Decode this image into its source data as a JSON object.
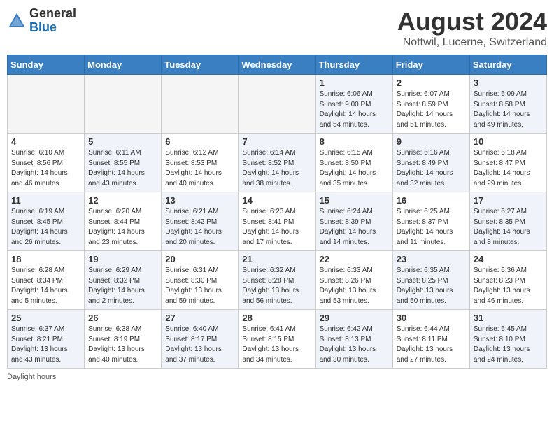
{
  "header": {
    "logo_line1": "General",
    "logo_line2": "Blue",
    "title": "August 2024",
    "subtitle": "Nottwil, Lucerne, Switzerland"
  },
  "days_of_week": [
    "Sunday",
    "Monday",
    "Tuesday",
    "Wednesday",
    "Thursday",
    "Friday",
    "Saturday"
  ],
  "weeks": [
    [
      {
        "day": "",
        "info": "",
        "empty": true
      },
      {
        "day": "",
        "info": "",
        "empty": true
      },
      {
        "day": "",
        "info": "",
        "empty": true
      },
      {
        "day": "",
        "info": "",
        "empty": true
      },
      {
        "day": "1",
        "info": "Sunrise: 6:06 AM\nSunset: 9:00 PM\nDaylight: 14 hours\nand 54 minutes.",
        "empty": false
      },
      {
        "day": "2",
        "info": "Sunrise: 6:07 AM\nSunset: 8:59 PM\nDaylight: 14 hours\nand 51 minutes.",
        "empty": false
      },
      {
        "day": "3",
        "info": "Sunrise: 6:09 AM\nSunset: 8:58 PM\nDaylight: 14 hours\nand 49 minutes.",
        "empty": false
      }
    ],
    [
      {
        "day": "4",
        "info": "Sunrise: 6:10 AM\nSunset: 8:56 PM\nDaylight: 14 hours\nand 46 minutes.",
        "empty": false
      },
      {
        "day": "5",
        "info": "Sunrise: 6:11 AM\nSunset: 8:55 PM\nDaylight: 14 hours\nand 43 minutes.",
        "empty": false
      },
      {
        "day": "6",
        "info": "Sunrise: 6:12 AM\nSunset: 8:53 PM\nDaylight: 14 hours\nand 40 minutes.",
        "empty": false
      },
      {
        "day": "7",
        "info": "Sunrise: 6:14 AM\nSunset: 8:52 PM\nDaylight: 14 hours\nand 38 minutes.",
        "empty": false
      },
      {
        "day": "8",
        "info": "Sunrise: 6:15 AM\nSunset: 8:50 PM\nDaylight: 14 hours\nand 35 minutes.",
        "empty": false
      },
      {
        "day": "9",
        "info": "Sunrise: 6:16 AM\nSunset: 8:49 PM\nDaylight: 14 hours\nand 32 minutes.",
        "empty": false
      },
      {
        "day": "10",
        "info": "Sunrise: 6:18 AM\nSunset: 8:47 PM\nDaylight: 14 hours\nand 29 minutes.",
        "empty": false
      }
    ],
    [
      {
        "day": "11",
        "info": "Sunrise: 6:19 AM\nSunset: 8:45 PM\nDaylight: 14 hours\nand 26 minutes.",
        "empty": false
      },
      {
        "day": "12",
        "info": "Sunrise: 6:20 AM\nSunset: 8:44 PM\nDaylight: 14 hours\nand 23 minutes.",
        "empty": false
      },
      {
        "day": "13",
        "info": "Sunrise: 6:21 AM\nSunset: 8:42 PM\nDaylight: 14 hours\nand 20 minutes.",
        "empty": false
      },
      {
        "day": "14",
        "info": "Sunrise: 6:23 AM\nSunset: 8:41 PM\nDaylight: 14 hours\nand 17 minutes.",
        "empty": false
      },
      {
        "day": "15",
        "info": "Sunrise: 6:24 AM\nSunset: 8:39 PM\nDaylight: 14 hours\nand 14 minutes.",
        "empty": false
      },
      {
        "day": "16",
        "info": "Sunrise: 6:25 AM\nSunset: 8:37 PM\nDaylight: 14 hours\nand 11 minutes.",
        "empty": false
      },
      {
        "day": "17",
        "info": "Sunrise: 6:27 AM\nSunset: 8:35 PM\nDaylight: 14 hours\nand 8 minutes.",
        "empty": false
      }
    ],
    [
      {
        "day": "18",
        "info": "Sunrise: 6:28 AM\nSunset: 8:34 PM\nDaylight: 14 hours\nand 5 minutes.",
        "empty": false
      },
      {
        "day": "19",
        "info": "Sunrise: 6:29 AM\nSunset: 8:32 PM\nDaylight: 14 hours\nand 2 minutes.",
        "empty": false
      },
      {
        "day": "20",
        "info": "Sunrise: 6:31 AM\nSunset: 8:30 PM\nDaylight: 13 hours\nand 59 minutes.",
        "empty": false
      },
      {
        "day": "21",
        "info": "Sunrise: 6:32 AM\nSunset: 8:28 PM\nDaylight: 13 hours\nand 56 minutes.",
        "empty": false
      },
      {
        "day": "22",
        "info": "Sunrise: 6:33 AM\nSunset: 8:26 PM\nDaylight: 13 hours\nand 53 minutes.",
        "empty": false
      },
      {
        "day": "23",
        "info": "Sunrise: 6:35 AM\nSunset: 8:25 PM\nDaylight: 13 hours\nand 50 minutes.",
        "empty": false
      },
      {
        "day": "24",
        "info": "Sunrise: 6:36 AM\nSunset: 8:23 PM\nDaylight: 13 hours\nand 46 minutes.",
        "empty": false
      }
    ],
    [
      {
        "day": "25",
        "info": "Sunrise: 6:37 AM\nSunset: 8:21 PM\nDaylight: 13 hours\nand 43 minutes.",
        "empty": false
      },
      {
        "day": "26",
        "info": "Sunrise: 6:38 AM\nSunset: 8:19 PM\nDaylight: 13 hours\nand 40 minutes.",
        "empty": false
      },
      {
        "day": "27",
        "info": "Sunrise: 6:40 AM\nSunset: 8:17 PM\nDaylight: 13 hours\nand 37 minutes.",
        "empty": false
      },
      {
        "day": "28",
        "info": "Sunrise: 6:41 AM\nSunset: 8:15 PM\nDaylight: 13 hours\nand 34 minutes.",
        "empty": false
      },
      {
        "day": "29",
        "info": "Sunrise: 6:42 AM\nSunset: 8:13 PM\nDaylight: 13 hours\nand 30 minutes.",
        "empty": false
      },
      {
        "day": "30",
        "info": "Sunrise: 6:44 AM\nSunset: 8:11 PM\nDaylight: 13 hours\nand 27 minutes.",
        "empty": false
      },
      {
        "day": "31",
        "info": "Sunrise: 6:45 AM\nSunset: 8:10 PM\nDaylight: 13 hours\nand 24 minutes.",
        "empty": false
      }
    ]
  ],
  "footer": "Daylight hours"
}
